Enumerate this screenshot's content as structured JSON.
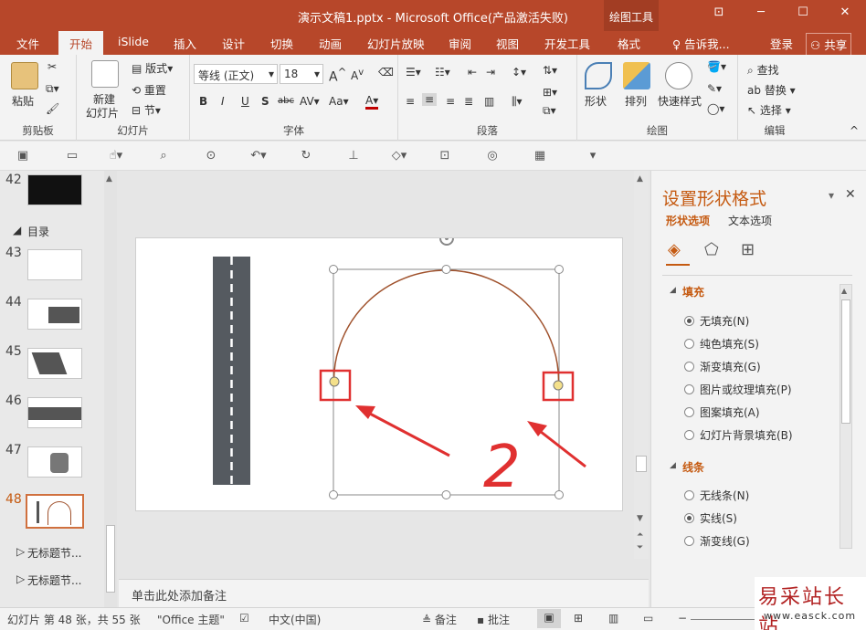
{
  "window": {
    "title": "演示文稿1.pptx - Microsoft Office(产品激活失败)",
    "context_tool": "绘图工具"
  },
  "tabs": [
    "文件",
    "开始",
    "iSlide",
    "插入",
    "设计",
    "切换",
    "动画",
    "幻灯片放映",
    "审阅",
    "视图",
    "开发工具",
    "格式"
  ],
  "active_tab": "开始",
  "tell_me": "告诉我...",
  "login": "登录",
  "share": "共享",
  "ribbon": {
    "clipboard": {
      "paste": "粘贴",
      "label": "剪贴板"
    },
    "slides": {
      "new_slide_1": "新建",
      "new_slide_2": "幻灯片",
      "layout": "版式",
      "reset": "重置",
      "section": "节",
      "label": "幻灯片"
    },
    "font": {
      "font_name": "等线 (正文)",
      "font_size": "18",
      "bold": "B",
      "italic": "I",
      "underline": "U",
      "shadow": "S",
      "strike": "abc",
      "spacing": "AV",
      "case": "Aa",
      "color": "A",
      "grow": "A",
      "shrink": "A",
      "label": "字体"
    },
    "paragraph": {
      "label": "段落"
    },
    "drawing": {
      "shapes": "形状",
      "arrange": "排列",
      "quick_styles": "快速样式",
      "label": "绘图"
    },
    "editing": {
      "find": "查找",
      "replace": "替换",
      "select": "选择",
      "label": "编辑"
    }
  },
  "thumbnails": {
    "items": [
      {
        "num": "42"
      },
      {
        "num": "43"
      },
      {
        "num": "44"
      },
      {
        "num": "45"
      },
      {
        "num": "46"
      },
      {
        "num": "47"
      },
      {
        "num": "48"
      }
    ],
    "section_top": "目录",
    "sections_bottom": [
      "无标题节...",
      "无标题节..."
    ]
  },
  "notes_placeholder": "单击此处添加备注",
  "annotation_text": "2",
  "pane": {
    "title": "设置形状格式",
    "tab_shape": "形状选项",
    "tab_text": "文本选项",
    "fill_section": "填充",
    "fill_options": [
      "无填充(N)",
      "纯色填充(S)",
      "渐变填充(G)",
      "图片或纹理填充(P)",
      "图案填充(A)",
      "幻灯片背景填充(B)"
    ],
    "fill_selected": 0,
    "line_section": "线条",
    "line_options": [
      "无线条(N)",
      "实线(S)",
      "渐变线(G)"
    ],
    "line_selected": 1
  },
  "status": {
    "slide_info": "幻灯片 第 48 张，共 55 张",
    "theme": "\"Office 主题\"",
    "language": "中文(中国)",
    "notes": "备注",
    "comments": "批注"
  },
  "watermark": {
    "brand": "易采站长站",
    "url": "www.easck.com"
  },
  "colors": {
    "accent": "#b7472a",
    "pane_title": "#c55a11",
    "arc": "#a0522d",
    "highlight": "#e03030"
  }
}
